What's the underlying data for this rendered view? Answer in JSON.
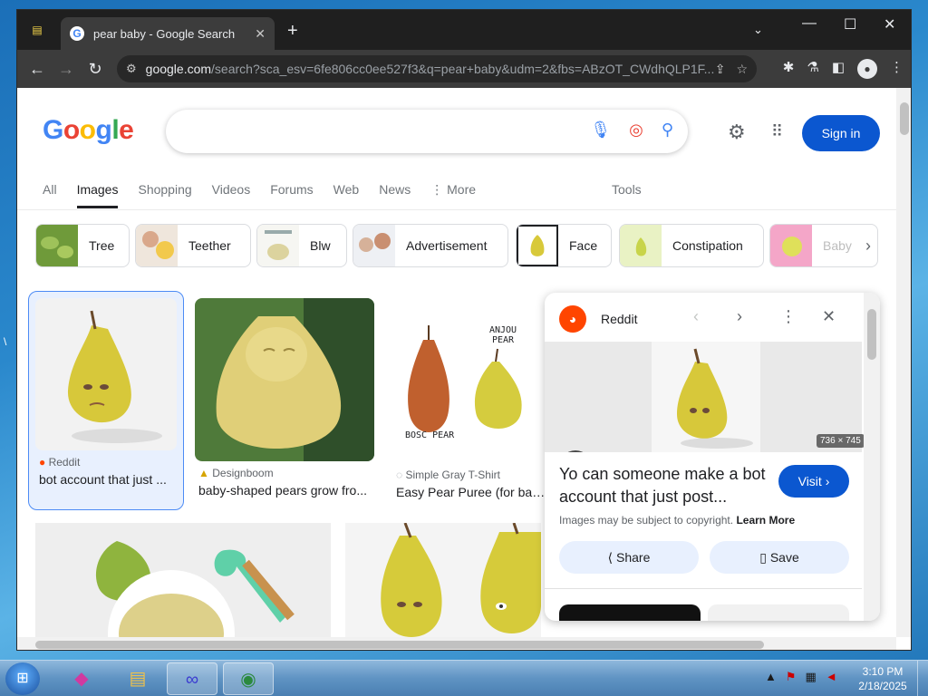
{
  "browser": {
    "tab_title": "pear baby - Google Search",
    "url_host": "google.com",
    "url_path": "/search?sca_esv=6fe806cc0ee527f3&q=pear+baby&udm=2&fbs=ABzOT_CWdhQLP1F..."
  },
  "google": {
    "logo_text": "Google",
    "sign_in": "Sign in",
    "filters": [
      "All",
      "Images",
      "Shopping",
      "Videos",
      "Forums",
      "Web",
      "News",
      "More"
    ],
    "active_filter": "Images",
    "tools": "Tools",
    "chips": [
      "Tree",
      "Teether",
      "Blw",
      "Advertisement",
      "Face",
      "Constipation",
      "Baby"
    ]
  },
  "results": [
    {
      "source": "Reddit",
      "title": "bot account that just ..."
    },
    {
      "source": "Designboom",
      "title": "baby-shaped pears grow fro..."
    },
    {
      "source": "Simple Gray T-Shirt",
      "title": "Easy Pear Puree (for babie"
    }
  ],
  "image_labels": {
    "anjou": "ANJOU PEAR",
    "bosc": "BOSC PEAR"
  },
  "preview": {
    "site": "Reddit",
    "dimensions": "736 × 745",
    "title": "Yo can someone make a bot account that just post...",
    "visit": "Visit",
    "copyright": "Images may be subject to copyright.",
    "learn_more": "Learn More",
    "share": "Share",
    "save": "Save"
  },
  "taskbar": {
    "time": "3:10 PM",
    "date": "2/18/2025"
  },
  "colors": {
    "accent": "#0b57d0",
    "reddit": "#ff4500",
    "pear": "#d8c93a"
  }
}
